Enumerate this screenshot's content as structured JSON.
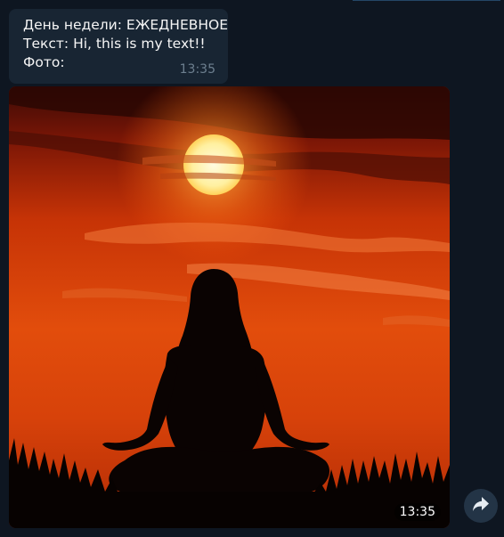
{
  "message": {
    "lines": [
      "День недели: ЕЖЕДНЕВНОЕ",
      "Текст: Hi, this is my text!!",
      "Фото:"
    ],
    "time": "13:35"
  },
  "photo": {
    "time": "13:35",
    "description_icon": "meditation-sunset-photo"
  },
  "forward": {
    "icon": "forward-arrow-icon"
  },
  "colors": {
    "background": "#0e1621",
    "bubble": "#182533",
    "text": "#f5f5f5",
    "time": "#6d7f8f",
    "forward_button": "#233446"
  }
}
